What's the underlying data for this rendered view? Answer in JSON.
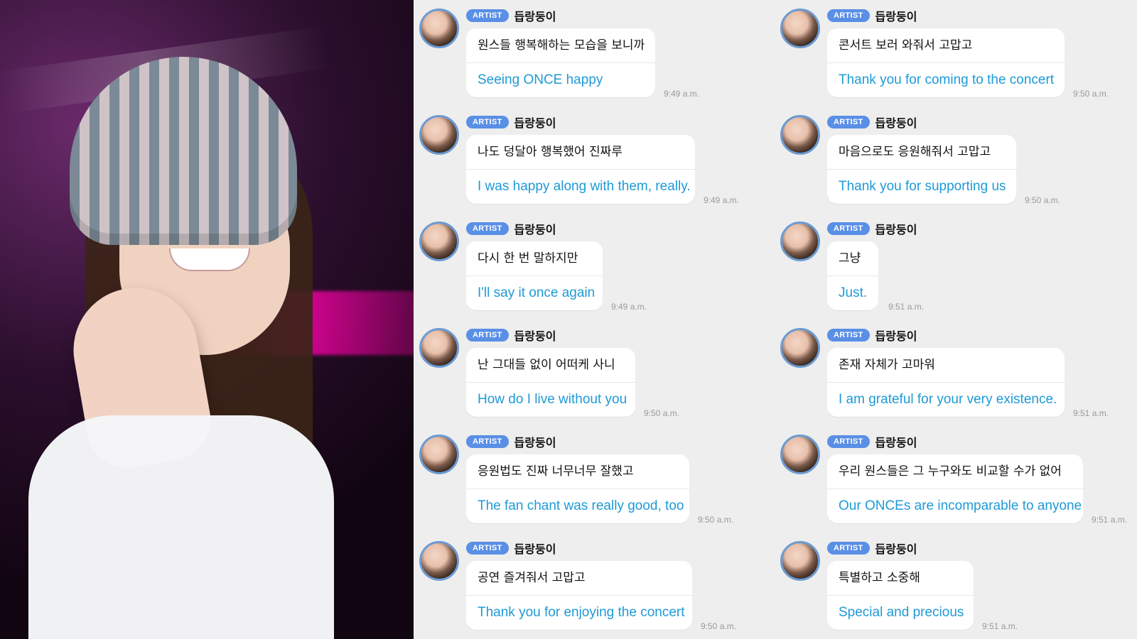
{
  "badge_label": "ARTIST",
  "sender_name": "듭랑둥이",
  "messages_left": [
    {
      "ko": "원스들 행복해하는 모습을 보니까",
      "en": "Seeing ONCE happy",
      "time": "9:49 a.m."
    },
    {
      "ko": "나도 덩달아 행복했어 진짜루",
      "en": "I was happy along with them, really.",
      "time": "9:49 a.m."
    },
    {
      "ko": "다시 한 번 말하지만",
      "en": "I'll say it once again",
      "time": "9:49 a.m."
    },
    {
      "ko": "난 그대들 없이 어떠케 사니",
      "en": "How do I live without you",
      "time": "9:50 a.m."
    },
    {
      "ko": "응원법도 진짜 너무너무 잘했고",
      "en": "The fan chant was really good, too",
      "time": "9:50 a.m."
    },
    {
      "ko": "공연 즐겨줘서 고맙고",
      "en": "Thank you for enjoying the concert",
      "time": "9:50 a.m."
    }
  ],
  "messages_right": [
    {
      "ko": "콘서트 보러 와줘서 고맙고",
      "en": "Thank you for coming to the concert",
      "time": "9:50 a.m."
    },
    {
      "ko": "마음으로도 응원해줘서 고맙고",
      "en": "Thank you for supporting us",
      "time": "9:50 a.m."
    },
    {
      "ko": "그냥",
      "en": "Just.",
      "time": "9:51 a.m."
    },
    {
      "ko": "존재 자체가 고마워",
      "en": "I am grateful for your very existence.",
      "time": "9:51 a.m."
    },
    {
      "ko": "우리 원스들은 그 누구와도 비교할 수가 없어",
      "en": "Our ONCEs are incomparable to anyone",
      "time": "9:51 a.m."
    },
    {
      "ko": "특별하고 소중해",
      "en": "Special and precious",
      "time": "9:51 a.m."
    }
  ],
  "colors": {
    "badge_bg": "#5a8fe6",
    "translation_text": "#1e9ad6",
    "chat_bg": "#eeeeee"
  }
}
